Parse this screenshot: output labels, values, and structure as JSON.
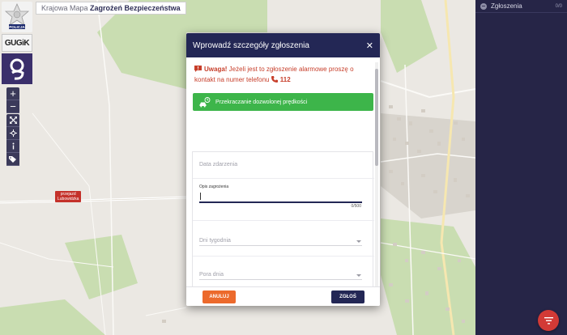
{
  "app": {
    "title_prefix": "Krajowa Mapa",
    "title_main": "Zagrożeń Bezpieczeństwa",
    "police_logo_text": "POLICJA",
    "gugik_logo_text": "GUGiK"
  },
  "map": {
    "zoom_in": "+",
    "zoom_out": "−",
    "place_label_line1": "przejazd",
    "place_label_line2": "Lubowidzka"
  },
  "panel": {
    "title": "Zgłoszenia",
    "count": "0/0"
  },
  "modal": {
    "title": "Wprowadź szczegóły zgłoszenia",
    "close": "✕",
    "warning_bold": "Uwaga!",
    "warning_text": " Jeżeli jest to zgłoszenie alarmowe proszę o kontakt na numer telefonu ",
    "warning_phone": "112",
    "category": "Przekraczanie dozwolonej prędkości",
    "fields": {
      "date_placeholder": "Data zdarzenia",
      "description_label": "Opis zagrożenia",
      "description_counter": "0/500",
      "days_placeholder": "Dni tygodnia",
      "time_placeholder": "Pora dnia"
    },
    "cancel_label": "ANULUJ",
    "submit_label": "ZGŁOŚ"
  },
  "colors": {
    "header": "#232755",
    "warning": "#c73e2a",
    "category": "#3db54a",
    "cancel": "#ec6a2c",
    "fab": "#d23a36"
  }
}
